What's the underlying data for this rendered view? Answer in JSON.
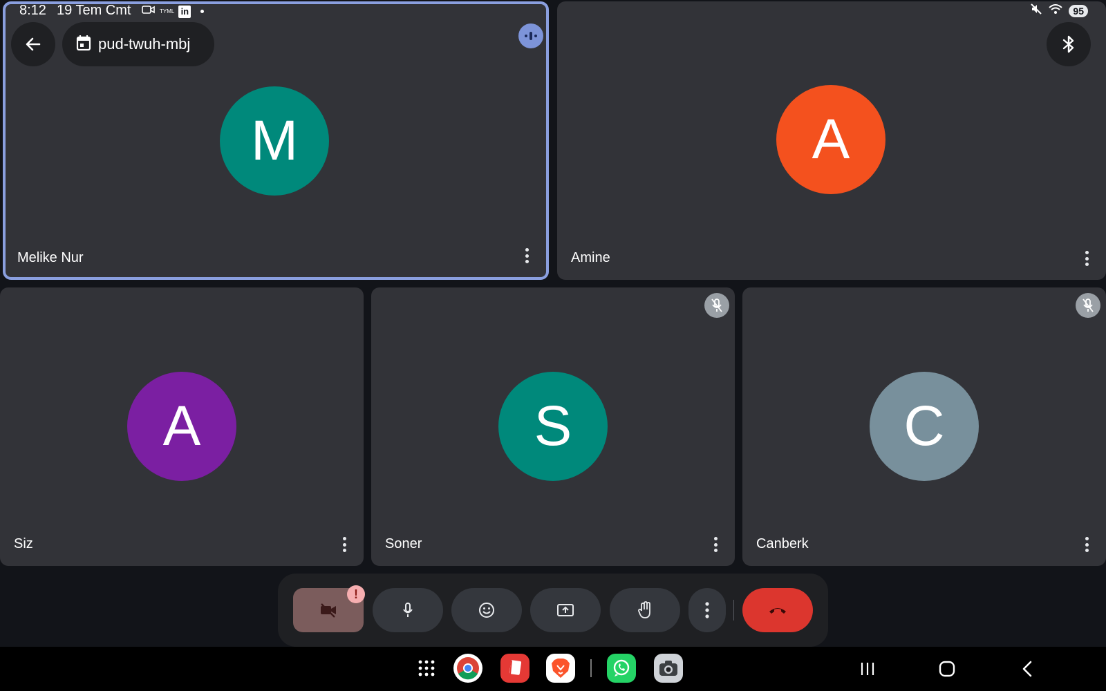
{
  "status_bar": {
    "time": "8:12",
    "date": "19 Tem Cmt",
    "notif_tyml": "TYML",
    "notif_linkedin": "in",
    "battery": "95"
  },
  "meeting": {
    "code": "pud-twuh-mbj"
  },
  "participants": [
    {
      "name": "Melike Nur",
      "initial": "M",
      "color": "#00897b"
    },
    {
      "name": "Amine",
      "initial": "A",
      "color": "#f4511e"
    },
    {
      "name": "Siz",
      "initial": "A",
      "color": "#7b1fa2"
    },
    {
      "name": "Soner",
      "initial": "S",
      "color": "#00897b"
    },
    {
      "name": "Canberk",
      "initial": "C",
      "color": "#78909c"
    }
  ],
  "controls": {
    "camera_alert": "!"
  },
  "colors": {
    "background": "#121419",
    "tile": "#323338",
    "active_border": "#8a9fdf",
    "end_call": "#dc362e"
  }
}
